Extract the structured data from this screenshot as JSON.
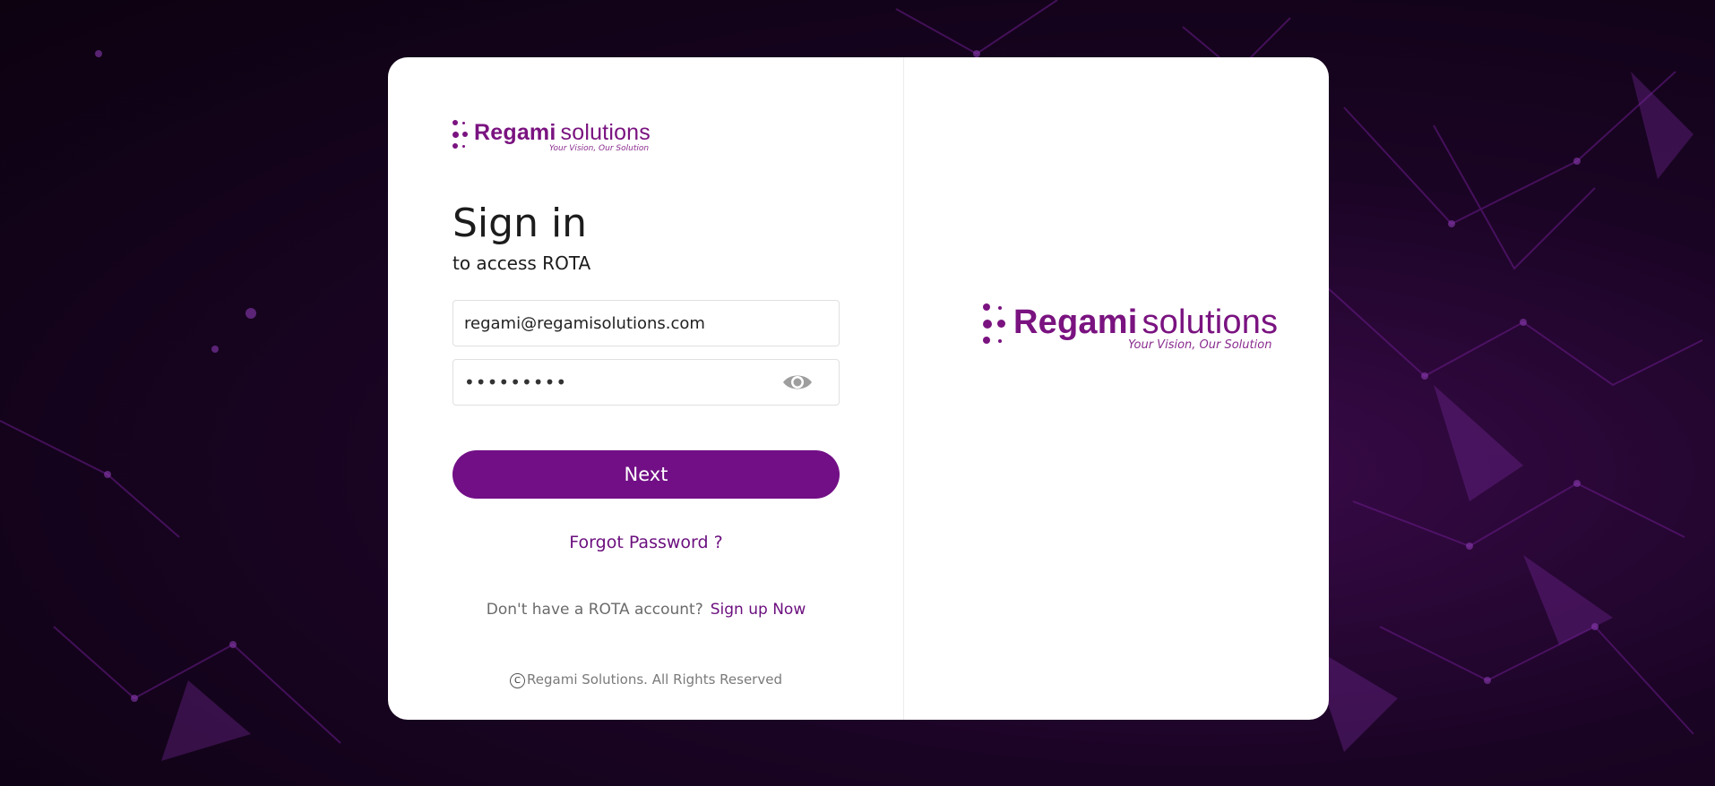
{
  "brand": {
    "name_bold": "Regami",
    "name_light": "solutions",
    "tagline": "Your Vision, Our Solution",
    "color": "#7a1380"
  },
  "signin": {
    "title": "Sign in",
    "subtitle": "to access ROTA"
  },
  "form": {
    "email_value": "regami@regamisolutions.com",
    "password_masked": "•••••••••",
    "password_toggle_icon": "eye-icon",
    "next_label": "Next",
    "forgot_label": "Forgot Password ?"
  },
  "signup": {
    "prompt": "Don't have a ROTA account?",
    "link": "Sign up Now"
  },
  "footer": {
    "copyright_symbol": "C",
    "copyright_text": "Regami Solutions. All Rights Reserved"
  },
  "colors": {
    "accent": "#720f86",
    "link": "#6b0f7e",
    "background": "#12031a"
  }
}
